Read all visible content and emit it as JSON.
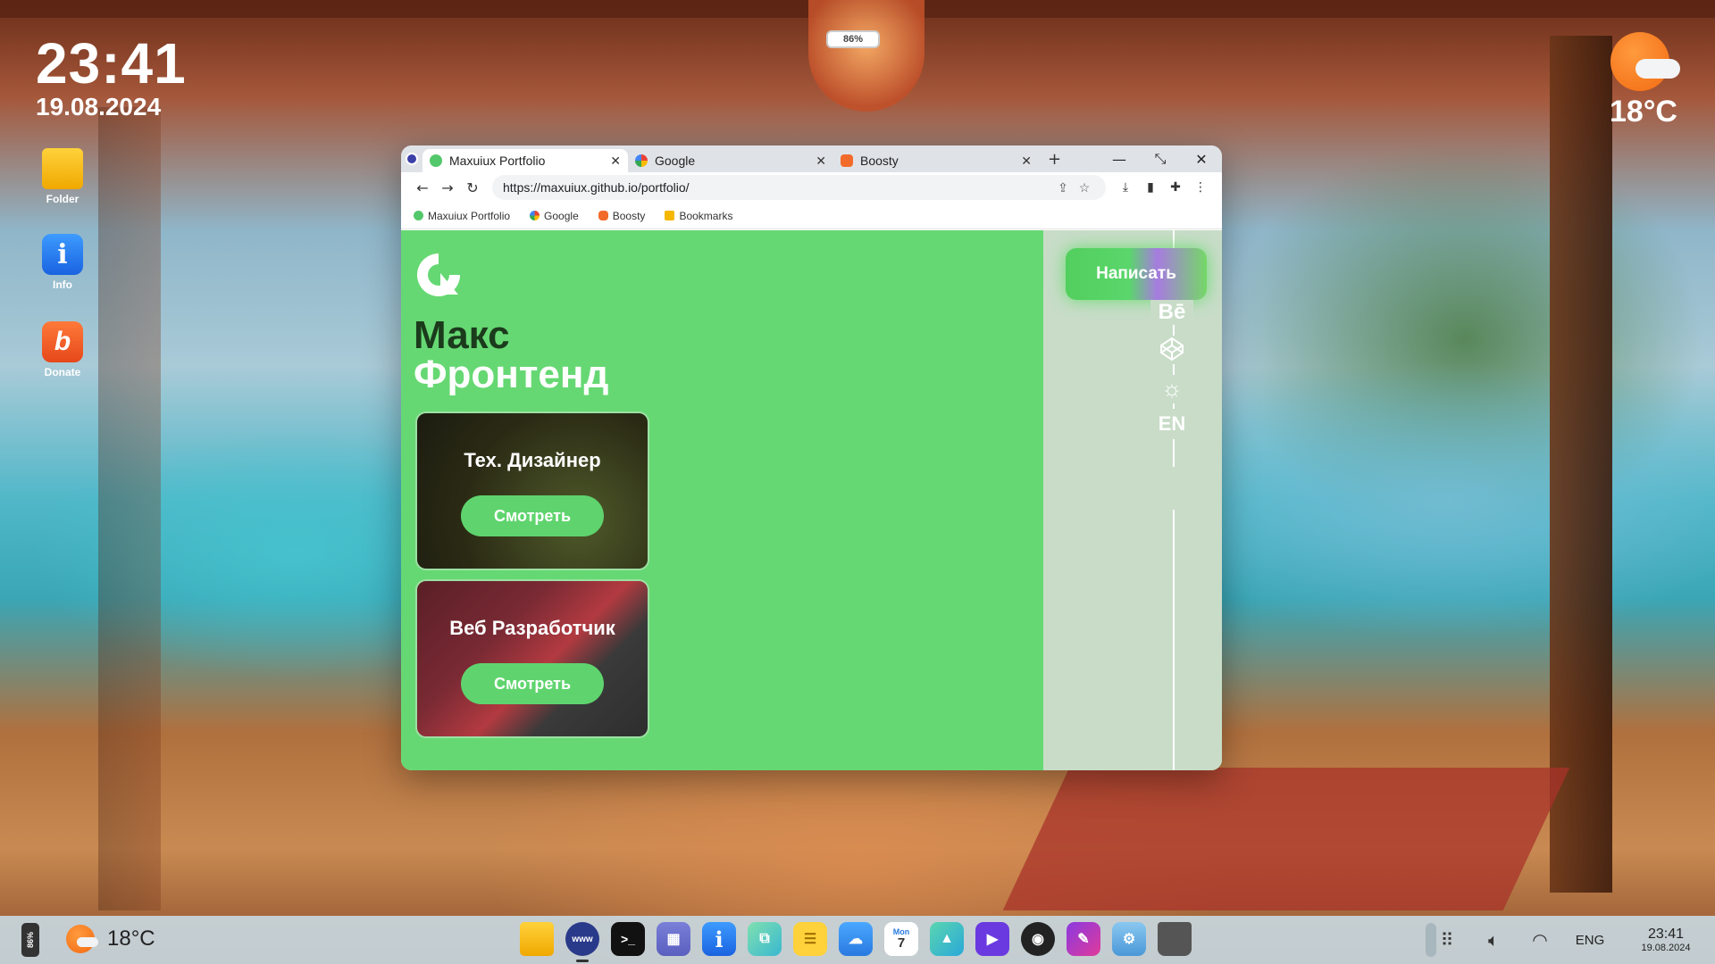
{
  "desktop": {
    "time": "23:41",
    "date": "19.08.2024",
    "battery_percent": "86%",
    "weather_temp": "18°C",
    "icons": [
      {
        "label": "Folder",
        "icon": "folder-icon"
      },
      {
        "label": "Info",
        "icon": "info-icon"
      },
      {
        "label": "Donate",
        "icon": "boosty-icon"
      }
    ]
  },
  "browser": {
    "tabs": [
      {
        "title": "Maxuiux Portfolio",
        "active": true
      },
      {
        "title": "Google",
        "active": false
      },
      {
        "title": "Boosty",
        "active": false
      }
    ],
    "new_tab": "+",
    "url": "https://maxuiux.github.io/portfolio/",
    "bookmarks": [
      "Maxuiux Portfolio",
      "Google",
      "Boosty",
      "Bookmarks"
    ]
  },
  "page": {
    "name": "Макс",
    "role": "Фронтенд",
    "write_button": "Написать",
    "behance": "Bē",
    "lang": "EN",
    "cards": [
      {
        "title": "Тех. Дизайнер",
        "button": "Смотреть"
      },
      {
        "title": "Веб Разработчик",
        "button": "Смотреть"
      }
    ]
  },
  "taskbar": {
    "battery": "86%",
    "weather_temp": "18°C",
    "language": "ENG",
    "time": "23:41",
    "date": "19.08.2024",
    "calendar_day": "Mon",
    "calendar_date": "7",
    "browser_label": "www",
    "terminal_label": ">_",
    "apps": [
      "files",
      "browser",
      "terminal",
      "calculator",
      "info",
      "code",
      "notes",
      "weather",
      "calendar",
      "photos",
      "video",
      "camera",
      "paint",
      "settings",
      "trash"
    ]
  }
}
